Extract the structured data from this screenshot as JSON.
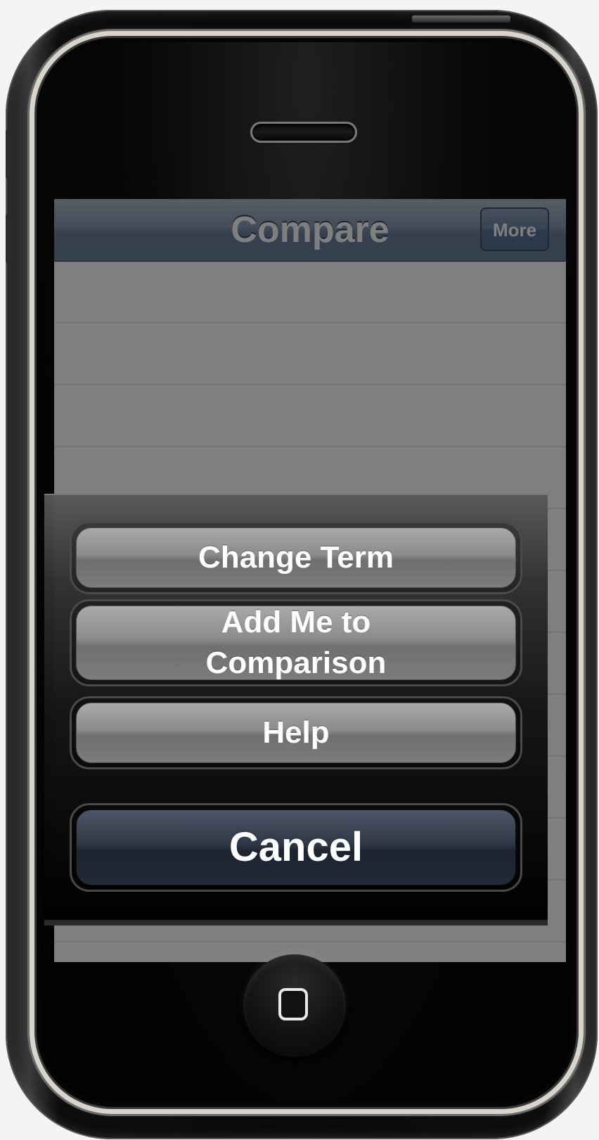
{
  "device": {
    "name": "iPhone",
    "body_color": "#0a0a0a",
    "rim_color": "#d9d4cb"
  },
  "nav_bar": {
    "title": "Compare",
    "more_label": "More",
    "accent": "#6d82a0"
  },
  "action_sheet": {
    "buttons": [
      {
        "label": "Change Term"
      },
      {
        "label": "Add Me to Comparison"
      },
      {
        "label": "Help"
      },
      {
        "label": "Cancel"
      }
    ]
  }
}
